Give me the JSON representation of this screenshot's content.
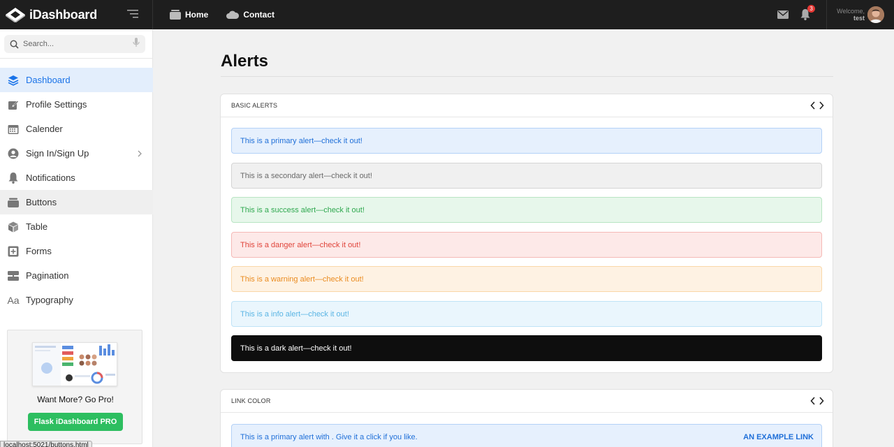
{
  "brand": {
    "name": "iDashboard"
  },
  "topnav": [
    {
      "label": "Home",
      "icon": "inbox-tray-icon"
    },
    {
      "label": "Contact",
      "icon": "cloud-icon"
    }
  ],
  "header": {
    "notifications_count": "3",
    "welcome_label": "Welcome,",
    "username": "test"
  },
  "sidebar": {
    "search_placeholder": "Search...",
    "items": [
      {
        "label": "Dashboard",
        "icon": "layers-icon"
      },
      {
        "label": "Profile Settings",
        "icon": "edit-icon"
      },
      {
        "label": "Calender",
        "icon": "calendar-icon"
      },
      {
        "label": "Sign In/Sign Up",
        "icon": "user-circle-icon"
      },
      {
        "label": "Notifications",
        "icon": "bell-icon"
      },
      {
        "label": "Buttons",
        "icon": "tray-icon"
      },
      {
        "label": "Table",
        "icon": "cube-icon"
      },
      {
        "label": "Forms",
        "icon": "plus-square-icon"
      },
      {
        "label": "Pagination",
        "icon": "pagination-icon"
      },
      {
        "label": "Typography",
        "icon": "typography-icon"
      }
    ],
    "promo": {
      "title": "Want More? Go Pro!",
      "button": "Flask iDashboard PRO"
    }
  },
  "status_url": "localhost:5021/buttons.html",
  "main": {
    "title": "Alerts",
    "basic_alerts": {
      "header": "BASIC ALERTS",
      "alerts": [
        {
          "variant": "primary",
          "text": "This is a primary alert—check it out!"
        },
        {
          "variant": "secondary",
          "text": "This is a secondary alert—check it out!"
        },
        {
          "variant": "success",
          "text": "This is a success alert—check it out!"
        },
        {
          "variant": "danger",
          "text": "This is a danger alert—check it out!"
        },
        {
          "variant": "warning",
          "text": "This is a warning alert—check it out!"
        },
        {
          "variant": "info",
          "text": "This is a info alert—check it out!"
        },
        {
          "variant": "dark",
          "text": "This is a dark alert—check it out!"
        }
      ]
    },
    "link_color": {
      "header": "LINK COLOR",
      "alert_text": "This is a primary alert with . Give it a click if you like.",
      "link_text": "AN EXAMPLE LINK"
    }
  },
  "colors": {
    "accent": "#1a73e8",
    "pro_green": "#2dbe60",
    "primary": {
      "bg": "#e6f0fd",
      "border": "#b3d1f7",
      "text": "#1f6fd8"
    },
    "secondary": {
      "bg": "#f0f0f0",
      "border": "#d4d4d4",
      "text": "#6a6a6a"
    },
    "success": {
      "bg": "#e7f7eb",
      "border": "#b8e5c3",
      "text": "#2fa84f"
    },
    "danger": {
      "bg": "#fde9e8",
      "border": "#f5b9b6",
      "text": "#e0443a"
    },
    "warning": {
      "bg": "#fef2e3",
      "border": "#f9d7a8",
      "text": "#ea8b1f"
    },
    "info": {
      "bg": "#eaf6fd",
      "border": "#bfe3f7",
      "text": "#5bb5e4"
    },
    "dark": {
      "bg": "#0e0e0e",
      "border": "#0e0e0e",
      "text": "#ffffff"
    }
  }
}
